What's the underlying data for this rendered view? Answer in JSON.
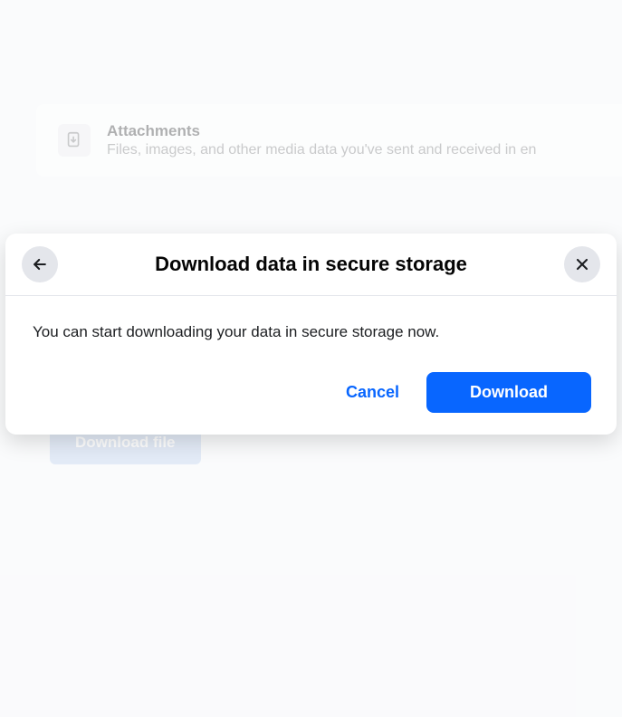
{
  "background": {
    "attachments": {
      "title": "Attachments",
      "subtitle": "Files, images, and other media data you've sent and received in en"
    },
    "download_file_label": "Download file"
  },
  "modal": {
    "title": "Download data in secure storage",
    "message": "You can start downloading your data in secure storage now.",
    "cancel_label": "Cancel",
    "download_label": "Download"
  }
}
